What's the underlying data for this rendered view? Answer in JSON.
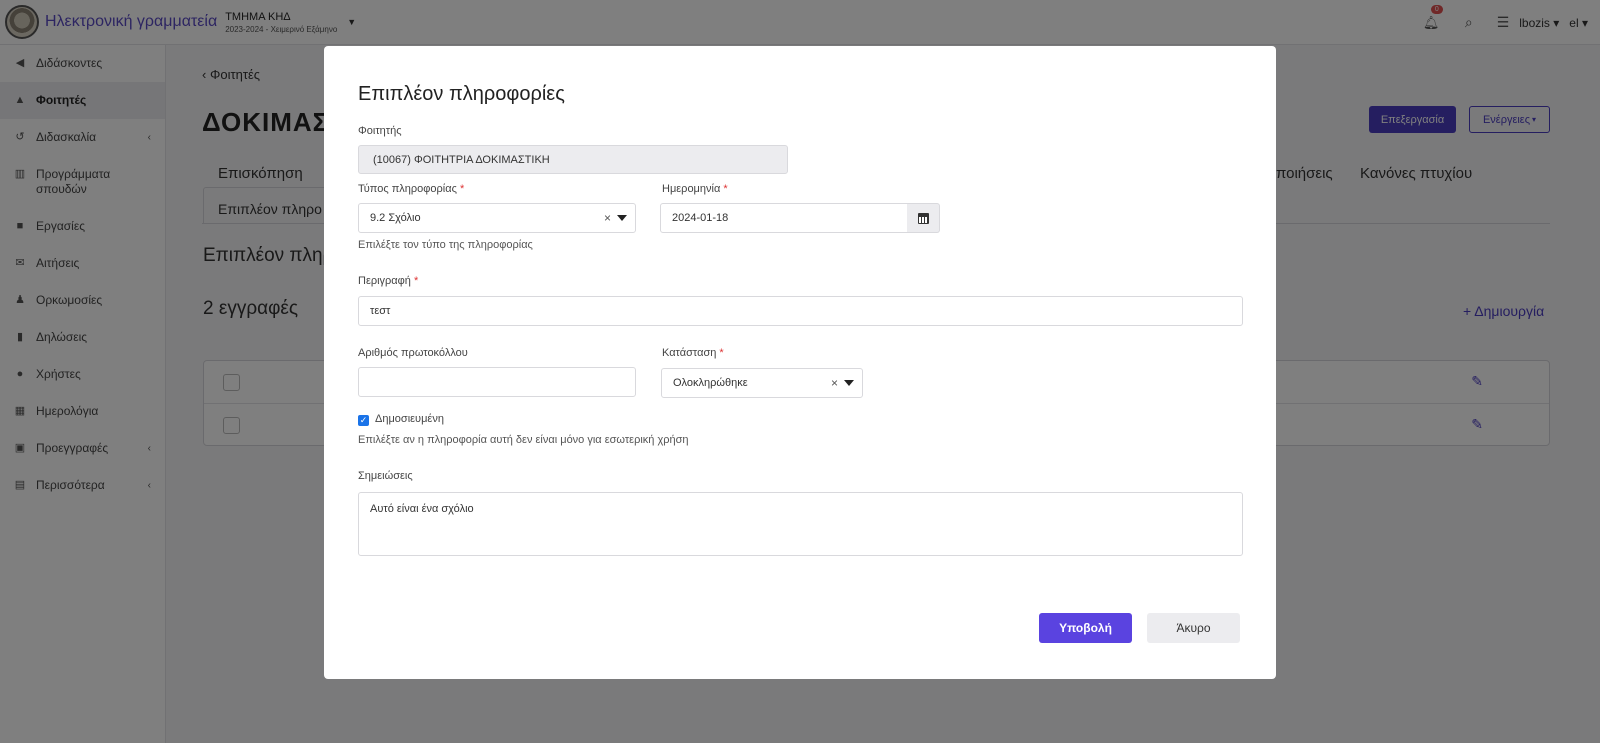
{
  "header": {
    "app_title": "Ηλεκτρονική γραμματεία",
    "department": "ΤΜΗΜΑ ΚΗΔ",
    "semester": "2023-2024 - Χειμερινό Εξάμηνο",
    "notification_count": "0",
    "username": "lbozis",
    "language": "el"
  },
  "sidebar": {
    "items": [
      {
        "label": "Διδάσκοντες",
        "icon": "megaphone-icon"
      },
      {
        "label": "Φοιτητές",
        "icon": "graduation-cap-icon"
      },
      {
        "label": "Διδασκαλία",
        "icon": "history-icon"
      },
      {
        "label": "Προγράμματα σπουδών",
        "icon": "institution-icon"
      },
      {
        "label": "Εργασίες",
        "icon": "briefcase-icon"
      },
      {
        "label": "Αιτήσεις",
        "icon": "envelope-icon"
      },
      {
        "label": "Ορκωμοσίες",
        "icon": "user-graduate-icon"
      },
      {
        "label": "Δηλώσεις",
        "icon": "clipboard-icon"
      },
      {
        "label": "Χρήστες",
        "icon": "user-icon"
      },
      {
        "label": "Ημερολόγια",
        "icon": "calendar-icon"
      },
      {
        "label": "Προεγγραφές",
        "icon": "id-card-icon"
      },
      {
        "label": "Περισσότερα",
        "icon": "archive-icon"
      }
    ]
  },
  "page": {
    "back_label": "Φοιτητές",
    "title": "ΔΟΚΙΜΑΣΤ",
    "edit_button": "Επεξεργασία",
    "actions_button": "Ενέργειες",
    "tabs": [
      "Επισκόπηση",
      "Επιπλέον πληρο",
      "ποιήσεις",
      "Κανόνες πτυχίου"
    ],
    "section_title": "Επιπλέον πληρ",
    "records_count": "2 εγγραφές",
    "create_link": "+ Δημιουργία"
  },
  "modal": {
    "title": "Επιπλέον πληροφορίες",
    "student_label": "Φοιτητής",
    "student_value": "(10067) ΦΟΙΤΗΤΡΙΑ ΔΟΚΙΜΑΣΤΙΚΗ",
    "info_type_label": "Τύπος πληροφορίας",
    "info_type_value": "9.2 Σχόλιο",
    "info_type_hint": "Επιλέξτε τον τύπο της πληροφορίας",
    "date_label": "Ημερομηνία",
    "date_value": "2024-01-18",
    "description_label": "Περιγραφή",
    "description_value": "τεστ",
    "protocol_label": "Αριθμός πρωτοκόλλου",
    "protocol_value": "",
    "status_label": "Κατάσταση",
    "status_value": "Ολοκληρώθηκε",
    "published_label": "Δημοσιευμένη",
    "published_checked": true,
    "published_hint": "Επιλέξτε αν η πληροφορία αυτή δεν είναι μόνο για εσωτερική χρήση",
    "notes_label": "Σημειώσεις",
    "notes_value": "Αυτό είναι ένα σχόλιο",
    "submit_button": "Υποβολή",
    "cancel_button": "Άκυρο",
    "required_marker": "*",
    "clear_glyph": "×"
  },
  "colors": {
    "accent": "#5a43e0",
    "brand": "#4b3cc1",
    "required": "#d33333"
  }
}
